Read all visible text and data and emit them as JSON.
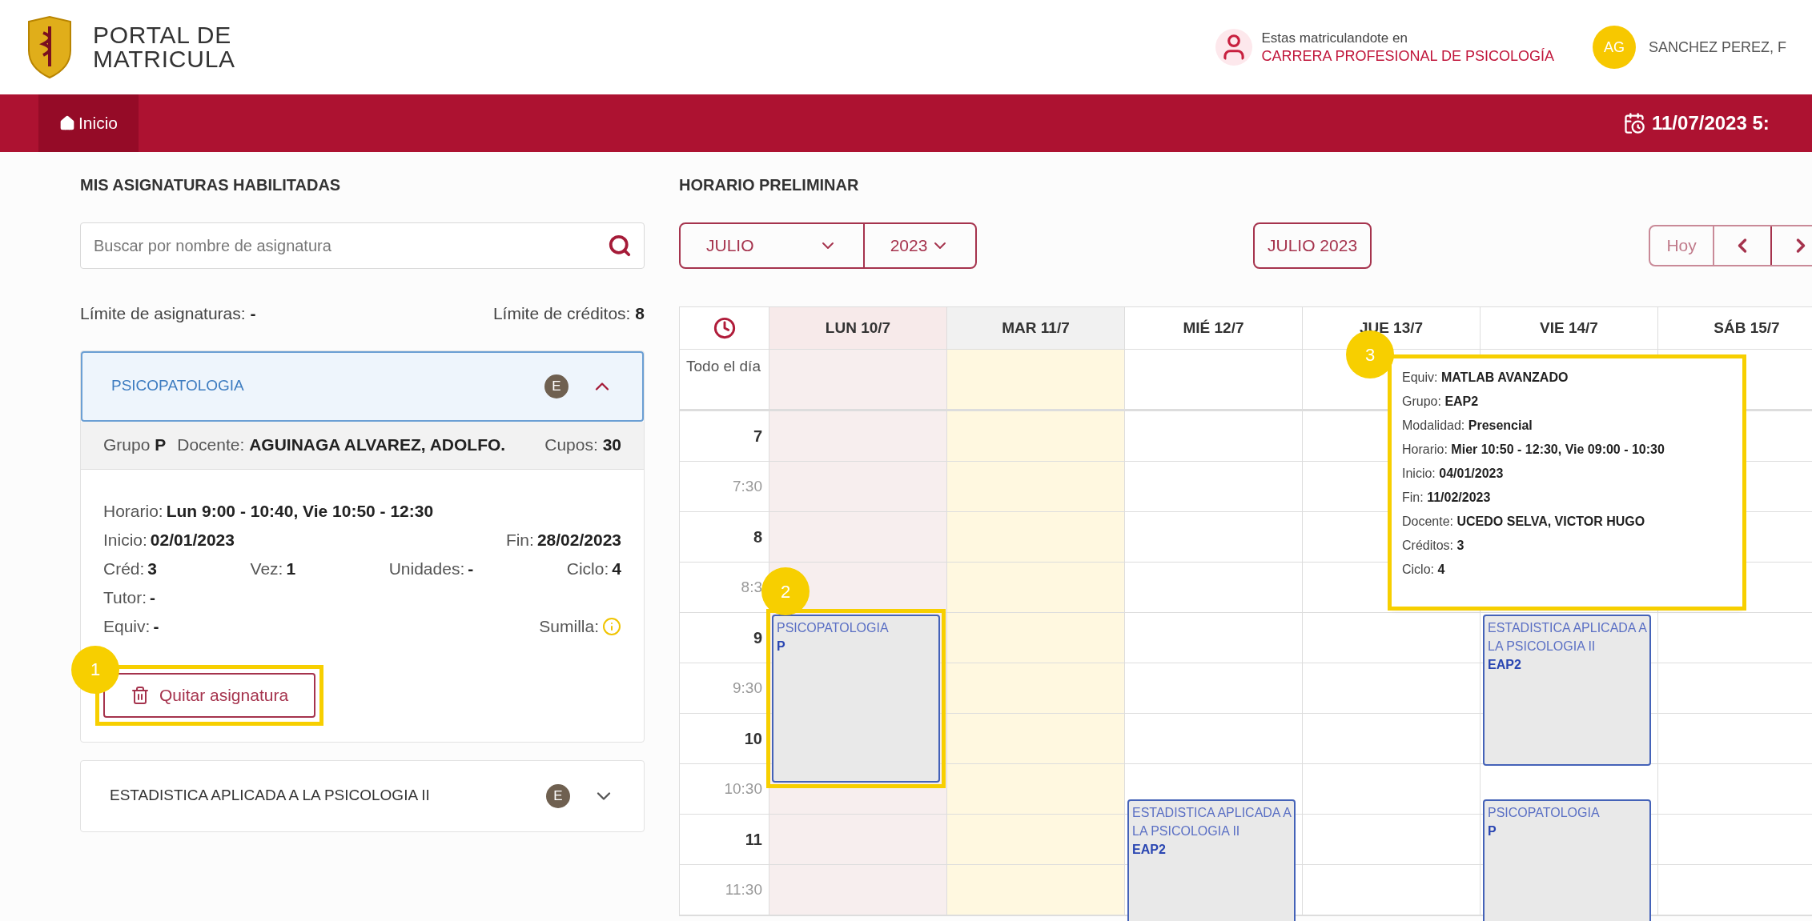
{
  "header": {
    "logo_lines": [
      "PORTAL DE",
      "MATRICULA"
    ],
    "enrollment": {
      "prefix": "Estas matriculandote en",
      "career": "CARRERA PROFESIONAL DE PSICOLOGÍA"
    },
    "user": {
      "initials": "AG",
      "name": "SANCHEZ PEREZ, F"
    }
  },
  "nav": {
    "items": [
      {
        "label": "Inicio",
        "selected": true
      }
    ],
    "datetime": "11/07/2023 5:"
  },
  "subjects": {
    "title": "MIS ASIGNATURAS HABILITADAS",
    "search": {
      "placeholder": "Buscar por nombre de asignatura"
    },
    "limits": [
      {
        "label": "Límite de asignaturas:",
        "value": "-"
      },
      {
        "label": "Límite de créditos:",
        "value": "8"
      }
    ],
    "courses": [
      {
        "name": "PSICOPATOLOGIA",
        "badge": "E",
        "expanded": true,
        "group_bar": [
          {
            "label": "Grupo",
            "value": "P"
          },
          {
            "label": "Docente:",
            "value": "AGUINAGA ALVAREZ, ADOLFO."
          },
          {
            "label": "Cupos:",
            "value": "30"
          }
        ],
        "detail_rows": [
          [
            {
              "label": "Horario:",
              "value": "Lun 9:00 - 10:40, Vie 10:50 - 12:30"
            }
          ],
          [
            {
              "label": "Inicio:",
              "value": "02/01/2023"
            },
            {
              "label": "Fin:",
              "value": "28/02/2023"
            }
          ],
          [
            {
              "label": "Créd:",
              "value": "3"
            },
            {
              "label": "Vez:",
              "value": "1"
            },
            {
              "label": "Unidades:",
              "value": "-"
            },
            {
              "label": "Ciclo:",
              "value": "4"
            }
          ],
          [
            {
              "label": "Tutor:",
              "value": "-"
            }
          ],
          [
            {
              "label": "Equiv:",
              "value": "-"
            },
            {
              "label": "Sumilla:",
              "kind": "info"
            }
          ]
        ],
        "remove_button": {
          "label": "Quitar asignatura",
          "callout": "1"
        }
      },
      {
        "name": "ESTADISTICA APLICADA A LA PSICOLOGIA II",
        "badge": "E",
        "expanded": false
      }
    ]
  },
  "schedule": {
    "title": "HORARIO PRELIMINAR",
    "month": "JULIO",
    "year": "2023",
    "period_label": "JULIO 2023",
    "today_button": "Hoy",
    "days": [
      {
        "label": "LUN 10/7",
        "selected": true,
        "today": false
      },
      {
        "label": "MAR 11/7",
        "selected": false,
        "today": true
      },
      {
        "label": "MIÉ 12/7",
        "selected": false,
        "today": false
      },
      {
        "label": "JUE 13/7",
        "selected": false,
        "today": false
      },
      {
        "label": "VIE 14/7",
        "selected": false,
        "today": false
      },
      {
        "label": "SÁB 15/7",
        "selected": false,
        "today": false
      }
    ],
    "all_day_label": "Todo el día",
    "times": [
      {
        "label": "7",
        "kind": "hour"
      },
      {
        "label": "7:30",
        "kind": "half"
      },
      {
        "label": "8",
        "kind": "hour"
      },
      {
        "label": "8:3",
        "kind": "half"
      },
      {
        "label": "9",
        "kind": "hour"
      },
      {
        "label": "9:30",
        "kind": "half"
      },
      {
        "label": "10",
        "kind": "hour"
      },
      {
        "label": "10:30",
        "kind": "half"
      },
      {
        "label": "11",
        "kind": "hour"
      },
      {
        "label": "11:30",
        "kind": "half"
      }
    ],
    "events": [
      {
        "title": "PSICOPATOLOGIA",
        "group": "P",
        "callout": "2"
      },
      {
        "title": "ESTADISTICA APLICADA A LA PSICOLOGIA II",
        "group": "EAP2"
      },
      {
        "title": "ESTADISTICA APLICADA A LA PSICOLOGIA II",
        "group": "EAP2"
      },
      {
        "title": "PSICOPATOLOGIA",
        "group": "P"
      }
    ],
    "tooltip": {
      "callout": "3",
      "lines": [
        {
          "label": "Equiv:",
          "value": "MATLAB AVANZADO"
        },
        {
          "label": "Grupo:",
          "value": "EAP2"
        },
        {
          "label": "Modalidad:",
          "value": "Presencial"
        },
        {
          "label": "Horario:",
          "value": "Mier 10:50 - 12:30, Vie 09:00 - 10:30"
        },
        {
          "label": "Inicio:",
          "value": "04/01/2023"
        },
        {
          "label": "Fin:",
          "value": "11/02/2023"
        },
        {
          "label": "Docente:",
          "value": "UCEDO SELVA, VICTOR HUGO"
        },
        {
          "label": "Créditos:",
          "value": "3"
        },
        {
          "label": "Ciclo:",
          "value": "4"
        }
      ]
    }
  }
}
